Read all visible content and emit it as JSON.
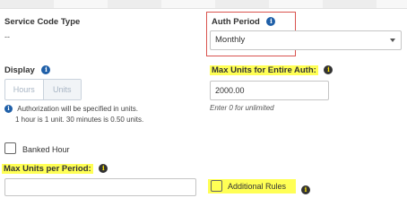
{
  "service_code_type": {
    "label": "Service Code Type",
    "value": "--"
  },
  "auth_period": {
    "label": "Auth Period",
    "info_glyph": "i",
    "selected": "Monthly"
  },
  "display": {
    "label": "Display",
    "info_glyph": "i",
    "options": [
      "Hours",
      "Units"
    ],
    "note_line1": "Authorization will be specified in units.",
    "note_line2": "1 hour is 1 unit. 30 minutes is 0.50 units."
  },
  "max_units_entire_auth": {
    "label": "Max Units for Entire Auth:",
    "info_glyph": "i",
    "value": "2000.00",
    "hint": "Enter 0 for unlimited"
  },
  "banked_hour": {
    "label": "Banked Hour"
  },
  "max_units_per_period": {
    "label": "Max Units per Period:",
    "info_glyph": "i",
    "value": ""
  },
  "additional_rules": {
    "label": "Additional Rules",
    "info_glyph": "i"
  },
  "colors": {
    "highlight": "#ffff55",
    "info_blue": "#1f5fa8",
    "alert_red": "#d9534f"
  },
  "icons": [
    "info-icon",
    "chevron-down-icon",
    "checkbox-icon"
  ]
}
